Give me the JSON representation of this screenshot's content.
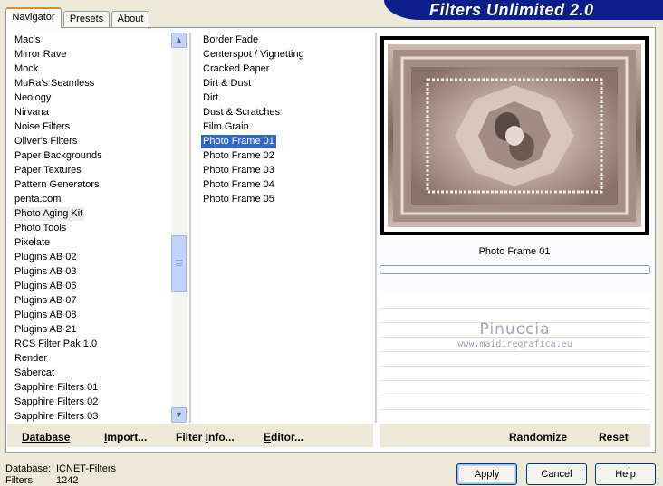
{
  "app": {
    "title": "Filters Unlimited 2.0"
  },
  "tabs": [
    {
      "label": "Navigator",
      "active": true
    },
    {
      "label": "Presets",
      "active": false
    },
    {
      "label": "About",
      "active": false
    }
  ],
  "categories": {
    "items": [
      "Mac's",
      "Mirror Rave",
      "Mock",
      "MuRa's Seamless",
      "Neology",
      "Nirvana",
      "Noise Filters",
      "Oliver's Filters",
      "Paper Backgrounds",
      "Paper Textures",
      "Pattern Generators",
      "penta.com",
      "Photo Aging Kit",
      "Photo Tools",
      "Pixelate",
      "Plugins AB 02",
      "Plugins AB 03",
      "Plugins AB 06",
      "Plugins AB 07",
      "Plugins AB 08",
      "Plugins AB 21",
      "RCS Filter Pak 1.0",
      "Render",
      "Sabercat",
      "Sapphire Filters 01",
      "Sapphire Filters 02",
      "Sapphire Filters 03"
    ],
    "highlighted": "Photo Aging Kit",
    "scroll_position": 0.62
  },
  "filters": {
    "items": [
      "Border Fade",
      "Centerspot / Vignetting",
      "Cracked Paper",
      "Dirt & Dust",
      "Dirt",
      "Dust & Scratches",
      "Film Grain",
      "Photo Frame 01",
      "Photo Frame 02",
      "Photo Frame 03",
      "Photo Frame 04",
      "Photo Frame 05"
    ],
    "selected": "Photo Frame 01"
  },
  "preview": {
    "filter_name": "Photo Frame 01",
    "progress": 0
  },
  "watermark": {
    "name": "Pinuccia",
    "url": "www.maidiregrafica.eu"
  },
  "toolbar": {
    "database": {
      "prefix": "",
      "underlined": "Database",
      "suffix": ""
    },
    "import": {
      "prefix": "",
      "underlined": "I",
      "suffix": "mport..."
    },
    "filter_info": {
      "prefix": "Filter ",
      "underlined": "I",
      "suffix": "nfo..."
    },
    "editor": {
      "prefix": "",
      "underlined": "E",
      "suffix": "ditor..."
    },
    "randomize": "Randomize",
    "reset": "Reset"
  },
  "info": {
    "database_label": "Database:",
    "database_value": "ICNET-Filters",
    "filters_label": "Filters:",
    "filters_value": "1242"
  },
  "buttons": {
    "apply": "Apply",
    "cancel": "Cancel",
    "help": "Help"
  },
  "colors": {
    "accent": "#0c1e8c",
    "selection": "#316ac5",
    "tab_active": "#e68b2c"
  }
}
